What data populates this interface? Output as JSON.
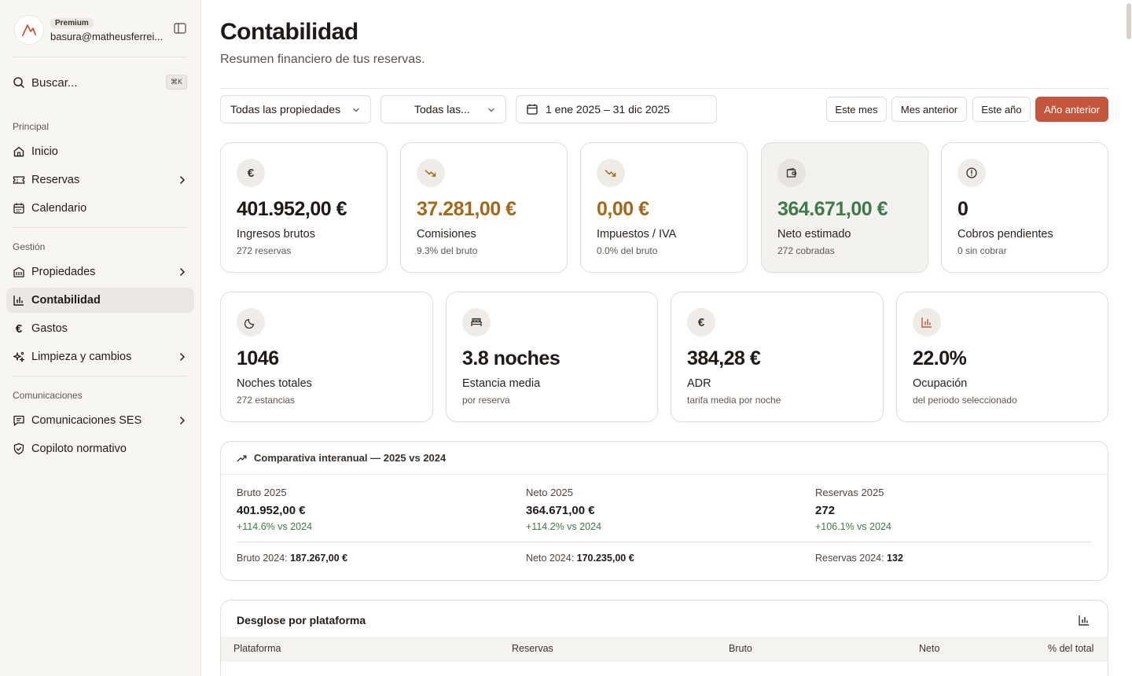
{
  "sidebar": {
    "badge": "Premium",
    "email": "basura@matheusferrei...",
    "search_label": "Buscar...",
    "search_shortcut": "⌘K",
    "sections": {
      "principal": "Principal",
      "gestion": "Gestión",
      "comunicaciones": "Comunicaciones"
    },
    "items": {
      "inicio": "Inicio",
      "reservas": "Reservas",
      "calendario": "Calendario",
      "propiedades": "Propiedades",
      "contabilidad": "Contabilidad",
      "gastos": "Gastos",
      "limpieza": "Limpieza y cambios",
      "ses": "Comunicaciones SES",
      "copiloto": "Copiloto normativo"
    }
  },
  "header": {
    "title": "Contabilidad",
    "subtitle": "Resumen financiero de tus reservas."
  },
  "filters": {
    "properties": "Todas las propiedades",
    "platforms": "Todas las...",
    "date_range": "1 ene 2025 – 31 dic 2025",
    "this_month": "Este mes",
    "prev_month": "Mes anterior",
    "this_year": "Este año",
    "prev_year": "Año anterior"
  },
  "kpis": {
    "gross": {
      "value": "401.952,00 €",
      "label": "Ingresos brutos",
      "sub": "272 reservas"
    },
    "commissions": {
      "value": "37.281,00 €",
      "label": "Comisiones",
      "sub": "9.3% del bruto"
    },
    "taxes": {
      "value": "0,00 €",
      "label": "Impuestos / IVA",
      "sub": "0.0% del bruto"
    },
    "net": {
      "value": "364.671,00 €",
      "label": "Neto estimado",
      "sub": "272 cobradas"
    },
    "pending": {
      "value": "0",
      "label": "Cobros pendientes",
      "sub": "0 sin cobrar"
    }
  },
  "stats": {
    "nights": {
      "value": "1046",
      "label": "Noches totales",
      "sub": "272 estancias"
    },
    "stay": {
      "value": "3.8 noches",
      "label": "Estancia media",
      "sub": "por reserva"
    },
    "adr": {
      "value": "384,28 €",
      "label": "ADR",
      "sub": "tarifa media por noche"
    },
    "occupancy": {
      "value": "22.0%",
      "label": "Ocupación",
      "sub": "del periodo seleccionado"
    }
  },
  "comparison": {
    "title": "Comparativa interanual — 2025 vs 2024",
    "gross": {
      "label": "Bruto 2025",
      "value": "401.952,00 €",
      "delta": "+114.6% vs 2024",
      "prev_label": "Bruto 2024:",
      "prev_value": "187.267,00 €"
    },
    "net": {
      "label": "Neto 2025",
      "value": "364.671,00 €",
      "delta": "+114.2% vs 2024",
      "prev_label": "Neto 2024:",
      "prev_value": "170.235,00 €"
    },
    "bookings": {
      "label": "Reservas 2025",
      "value": "272",
      "delta": "+106.1% vs 2024",
      "prev_label": "Reservas 2024:",
      "prev_value": "132"
    }
  },
  "breakdown": {
    "title": "Desglose por plataforma",
    "columns": [
      "Plataforma",
      "Reservas",
      "Bruto",
      "Neto",
      "% del total"
    ]
  },
  "colors": {
    "accent": "#c4563d",
    "commission": "#a5681a",
    "net": "#3f7a4c"
  }
}
